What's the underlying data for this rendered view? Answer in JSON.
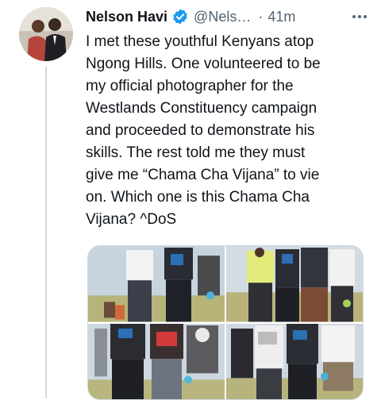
{
  "tweet": {
    "author_name": "Nelson Havi",
    "handle": "@Nels…",
    "separator": "·",
    "time": "41m",
    "text": "I met these youthful Kenyans atop\nNgong Hills. One volunteered to be\nmy official photographer for the\nWestlands Constituency campaign\nand proceeded to demonstrate his\nskills. The rest told me they must\ngive me “Chama Cha Vijana” to vie\non. Which one is this Chama Cha\nVijana? ^DoS",
    "photo_count": 4
  },
  "icons": {
    "verified": "verified-badge-icon",
    "more": "more-options-icon"
  },
  "colors": {
    "text_primary": "#0f1419",
    "text_secondary": "#536471",
    "verified_blue": "#1d9bf0",
    "border": "#cfd9de"
  }
}
